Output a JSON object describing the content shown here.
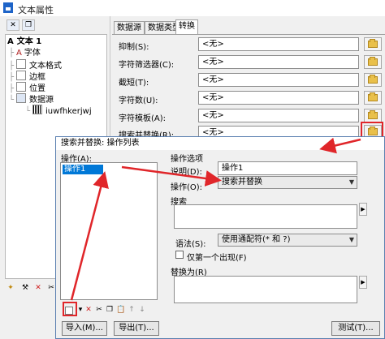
{
  "window": {
    "title": "文本属性"
  },
  "tree": {
    "root": "文本 1",
    "items": [
      "字体",
      "文本格式",
      "边框",
      "位置",
      "数据源"
    ],
    "leaf": "iuwfhkerjwj"
  },
  "tabs": [
    "数据源",
    "数据类型",
    "转换"
  ],
  "props": [
    {
      "label": "抑制(S):",
      "value": "<无>"
    },
    {
      "label": "字符筛选器(C):",
      "value": "<无>"
    },
    {
      "label": "截短(T):",
      "value": "<无>"
    },
    {
      "label": "字符数(U):",
      "value": "<无>"
    },
    {
      "label": "字符模板(A):",
      "value": "<无>"
    },
    {
      "label": "搜索并替换(R):",
      "value": "<无>"
    }
  ],
  "dialog": {
    "title": "搜索并替换: 操作列表",
    "ops_label": "操作(A):",
    "ops_items": [
      "操作1"
    ],
    "options_label": "操作选项",
    "desc_label": "说明(D):",
    "desc_value": "操作1",
    "op_label": "操作(O):",
    "op_value": "搜索并替换",
    "search_label": "搜索",
    "syntax_label": "语法(S):",
    "syntax_value": "使用通配符(* 和 ?)",
    "first_only_label": "仅第一个出现(F)",
    "replace_label": "替换为(R)",
    "import_btn": "导入(M)...",
    "export_btn": "导出(T)...",
    "test_btn": "测试(T)..."
  }
}
